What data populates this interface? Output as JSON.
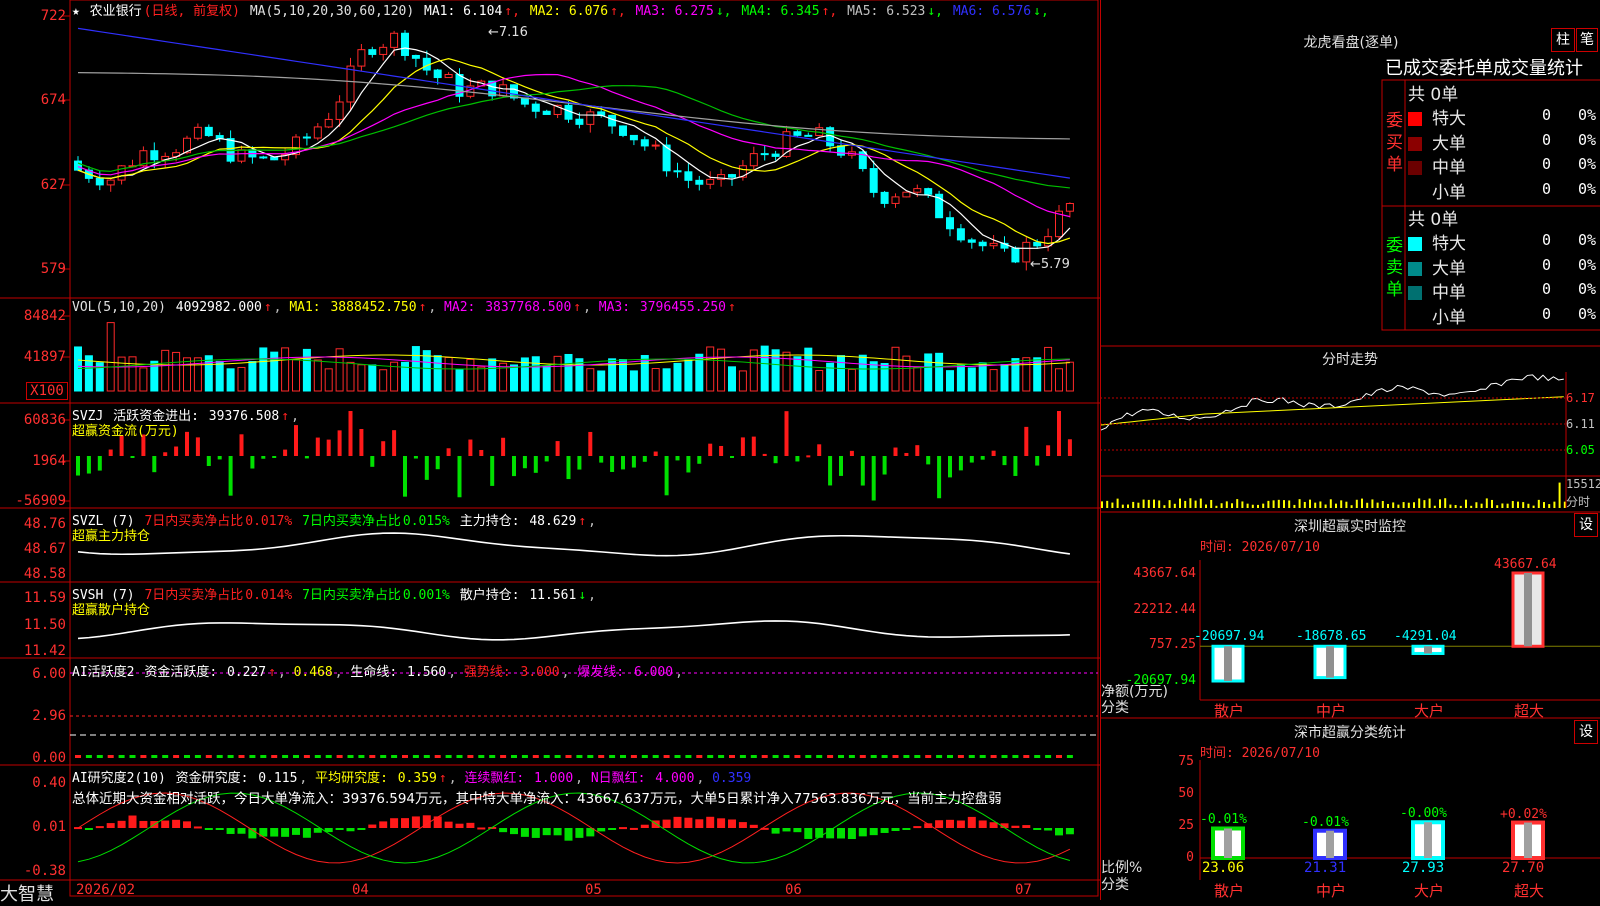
{
  "stock": {
    "name": "农业银行",
    "period": "(日线, 前复权)",
    "ma_spec": "MA(5,10,20,30,60,120)",
    "ma_values": [
      {
        "label": "MA1:",
        "value": "6.104",
        "arrow": "↑",
        "color": "#ffffff"
      },
      {
        "label": "MA2:",
        "value": "6.076",
        "arrow": "↑",
        "color": "#ffff00"
      },
      {
        "label": "MA3:",
        "value": "6.275",
        "arrow": "↓",
        "color": "#ff00ff"
      },
      {
        "label": "MA4:",
        "value": "6.345",
        "arrow": "↑",
        "color": "#00ff00"
      },
      {
        "label": "MA5:",
        "value": "6.523",
        "arrow": "↓",
        "color": "#c0c0c0"
      },
      {
        "label": "MA6:",
        "value": "6.576",
        "arrow": "↓",
        "color": "#3030ff"
      }
    ],
    "price_axis": [
      "722",
      "674",
      "627",
      "579"
    ],
    "high_label": "7.16",
    "low_label": "5.79"
  },
  "volume": {
    "spec": "VOL(5,10,20)",
    "value": "4092982.000",
    "ma1": "3888452.750",
    "ma2": "3837768.500",
    "ma3": "3796455.250",
    "axis": [
      "84842",
      "41897"
    ],
    "unit": "X100"
  },
  "svzj": {
    "name": "SVZJ",
    "label": "活跃资金进出:",
    "value": "39376.508",
    "subtitle": "超赢资金流(万元)",
    "axis": [
      "60836",
      "1964",
      "-56909"
    ]
  },
  "svzl": {
    "name": "SVZL (7)",
    "t1": "7日内买卖净占比",
    "v1": "0.017%",
    "t2": "7日内买卖净占比",
    "v2": "0.015%",
    "t3": "主力持仓:",
    "v3": "48.629",
    "subtitle": "超赢主力持仓",
    "axis": [
      "48.76",
      "48.67",
      "48.58"
    ]
  },
  "svsh": {
    "name": "SVSH (7)",
    "t1": "7日内买卖净占比",
    "v1": "0.014%",
    "t2": "7日内买卖净占比",
    "v2": "0.001%",
    "t3": "散户持仓:",
    "v3": "11.561",
    "subtitle": "超赢散户持仓",
    "axis": [
      "11.59",
      "11.50",
      "11.42"
    ]
  },
  "ai1": {
    "name": "AI活跃度2",
    "l1": "资金活跃度:",
    "v1": "0.227",
    "v2": "0.468",
    "l3": "生命线:",
    "v3": "1.560",
    "l4": "强势线:",
    "v4": "3.000",
    "l5": "爆发线:",
    "v5": "6.000",
    "axis": [
      "6.00",
      "2.96",
      "0.00"
    ]
  },
  "ai2": {
    "name": "AI研究度2(10)",
    "l1": "资金研究度:",
    "v1": "0.115",
    "l2": "平均研究度:",
    "v2": "0.359",
    "l3": "连续飘红:",
    "v3": "1.000",
    "l4": "N日飘红:",
    "v4": "4.000",
    "v5": "0.359",
    "summary": "总体近期大资金相对活跃，今日大单净流入：39376.594万元，其中特大单净流入：43667.637万元，大单5日累计净入77563.836万元，当前主力控盘弱",
    "axis": [
      "0.40",
      "0.01",
      "-0.38"
    ]
  },
  "dates": [
    "2026/02",
    "04",
    "05",
    "06",
    "07"
  ],
  "brand": "大智慧",
  "right": {
    "lhb_title": "龙虎看盘(逐单)",
    "tabs": [
      "柱",
      "笔"
    ],
    "stat_title": "已成交委托单成交量统计",
    "buy": {
      "side": "委买单",
      "total": "共 0单",
      "rows": [
        {
          "label": "特大",
          "n": "0",
          "p": "0%",
          "color": "#ff0000"
        },
        {
          "label": "大单",
          "n": "0",
          "p": "0%",
          "color": "#8b0000"
        },
        {
          "label": "中单",
          "n": "0",
          "p": "0%",
          "color": "#6b0000"
        },
        {
          "label": "小单",
          "n": "0",
          "p": "0%",
          "color": "#000000"
        }
      ]
    },
    "sell": {
      "side": "委卖单",
      "total": "共 0单",
      "rows": [
        {
          "label": "特大",
          "n": "0",
          "p": "0%",
          "color": "#00ffff"
        },
        {
          "label": "大单",
          "n": "0",
          "p": "0%",
          "color": "#008b8b"
        },
        {
          "label": "中单",
          "n": "0",
          "p": "0%",
          "color": "#007070"
        },
        {
          "label": "小单",
          "n": "0",
          "p": "0%",
          "color": "#000000"
        }
      ]
    },
    "intraday": {
      "title": "分时走势",
      "axis": [
        "6.17",
        "6.11",
        "6.05"
      ],
      "vol": "15512",
      "vol_unit": "分时"
    },
    "monitor": {
      "title": "深圳超赢实时监控",
      "set": "设",
      "time": "时间: 2026/07/10",
      "axis": [
        "43667.64",
        "22212.44",
        "757.25",
        "-20697.94"
      ],
      "ylabel": "净额(万元)",
      "xlabel": "分类",
      "bars": [
        {
          "cat": "散户",
          "value": "-20697.94"
        },
        {
          "cat": "中户",
          "value": "-18678.65"
        },
        {
          "cat": "大户",
          "value": "-4291.04"
        },
        {
          "cat": "超大",
          "value": "43667.64"
        }
      ]
    },
    "stats": {
      "title": "深市超赢分类统计",
      "set": "设",
      "time": "时间: 2026/07/10",
      "axis": [
        "75",
        "50",
        "25",
        "0"
      ],
      "ylabel": "比例%",
      "xlabel": "分类",
      "bars": [
        {
          "cat": "散户",
          "pct": "23.06",
          "chg": "-0.01%"
        },
        {
          "cat": "中户",
          "pct": "21.31",
          "chg": "-0.01%"
        },
        {
          "cat": "大户",
          "pct": "27.93",
          "chg": "-0.00%"
        },
        {
          "cat": "超大",
          "pct": "27.70",
          "chg": "+0.02%"
        }
      ]
    }
  },
  "chart_data": [
    {
      "type": "candlestick",
      "title": "农业银行",
      "ylim": [
        5.79,
        7.16
      ]
    },
    {
      "type": "bar",
      "title": "深圳超赢实时监控",
      "categories": [
        "散户",
        "中户",
        "大户",
        "超大"
      ],
      "values": [
        -20697.94,
        -18678.65,
        -4291.04,
        43667.64
      ],
      "ylabel": "净额(万元)"
    },
    {
      "type": "bar",
      "title": "深市超赢分类统计",
      "categories": [
        "散户",
        "中户",
        "大户",
        "超大"
      ],
      "values": [
        23.06,
        21.31,
        27.93,
        27.7
      ],
      "ylabel": "比例%"
    }
  ]
}
